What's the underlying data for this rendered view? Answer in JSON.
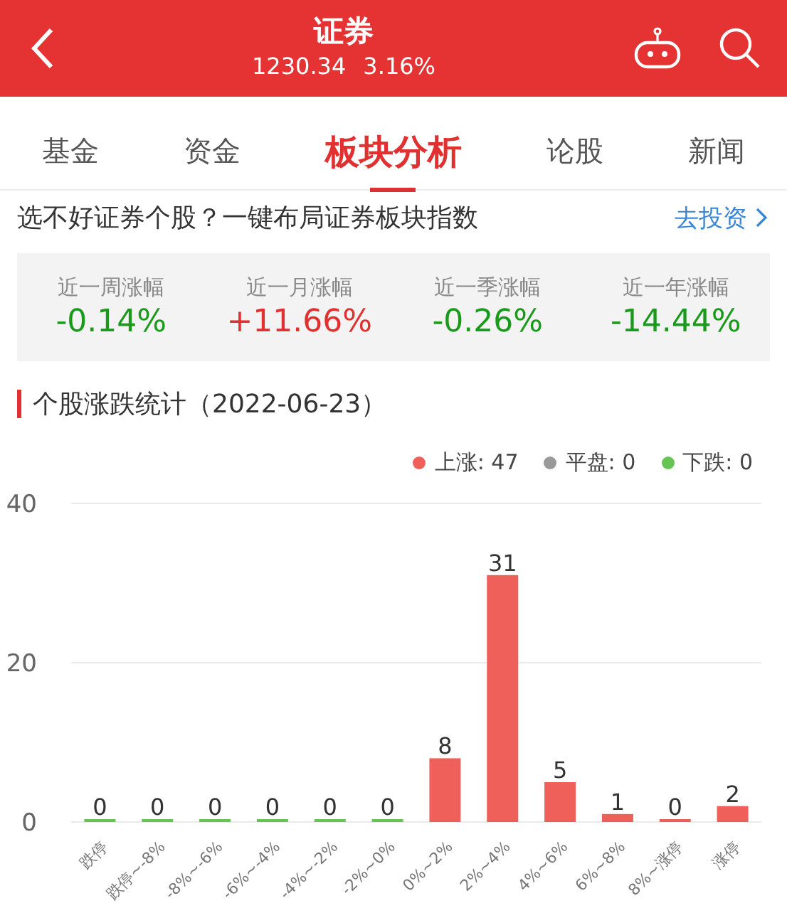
{
  "header": {
    "title": "证券",
    "price": "1230.34",
    "change": "3.16%"
  },
  "tabs": [
    {
      "label": "基金",
      "selected": false
    },
    {
      "label": "资金",
      "selected": false
    },
    {
      "label": "板块分析",
      "selected": true
    },
    {
      "label": "论股",
      "selected": false
    },
    {
      "label": "新闻",
      "selected": false
    }
  ],
  "promo": {
    "text": "选不好证券个股？一键布局证券板块指数",
    "link": "去投资"
  },
  "stats": [
    {
      "label": "近一周涨幅",
      "value": "-0.14%",
      "color": "#1a9a1a"
    },
    {
      "label": "近一月涨幅",
      "value": "+11.66%",
      "color": "#e03030"
    },
    {
      "label": "近一季涨幅",
      "value": "-0.26%",
      "color": "#1a9a1a"
    },
    {
      "label": "近一年涨幅",
      "value": "-14.44%",
      "color": "#1a9a1a"
    }
  ],
  "section": {
    "title": "个股涨跌统计（2022-06-23）",
    "legend": [
      {
        "label": "上涨: 47",
        "color": "#f0605a"
      },
      {
        "label": "平盘: 0",
        "color": "#999999"
      },
      {
        "label": "下跌: 0",
        "color": "#66c455"
      }
    ],
    "chart_data": {
      "type": "bar",
      "stacked": true,
      "data_labels": true,
      "ylim": [
        0,
        40
      ],
      "yticks": [
        0,
        20,
        40
      ],
      "categories": [
        "跌停",
        "跌停~-8%",
        "-8%~-6%",
        "-6%~-4%",
        "-4%~-2%",
        "-2%~0%",
        "0%~2%",
        "2%~4%",
        "4%~6%",
        "6%~8%",
        "8%~涨停",
        "涨停"
      ],
      "series": [
        {
          "color": "#66c455",
          "values": [
            0,
            0,
            0,
            0,
            0,
            0,
            null,
            null,
            null,
            null,
            null,
            null
          ]
        },
        {
          "color": "#f0605a",
          "values": [
            null,
            null,
            null,
            null,
            null,
            null,
            8,
            31,
            5,
            1,
            0,
            2
          ]
        }
      ]
    }
  }
}
